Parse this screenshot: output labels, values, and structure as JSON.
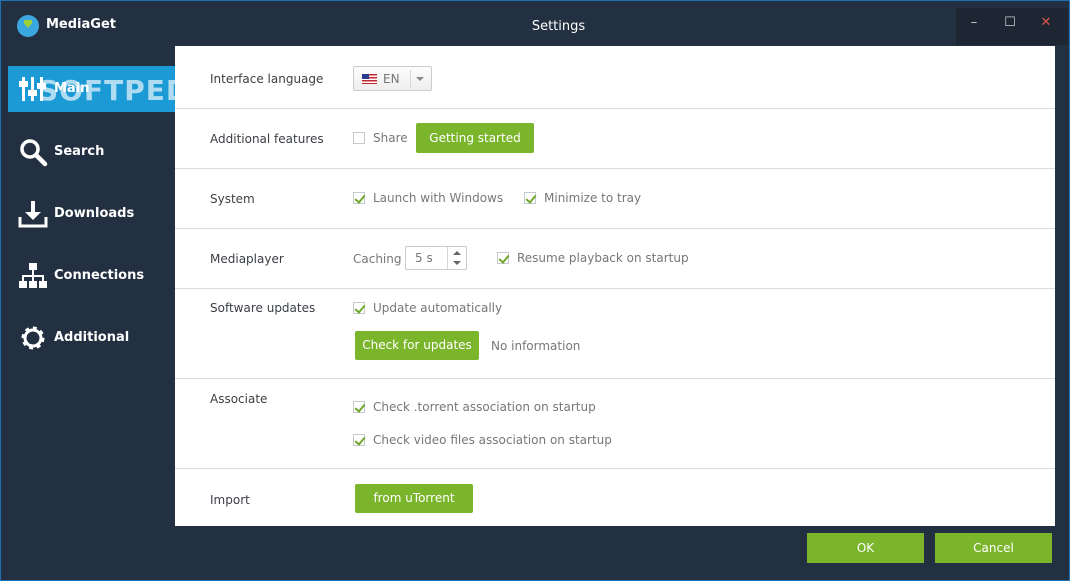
{
  "app": {
    "name": "MediaGet",
    "window_title": "Settings"
  },
  "window_controls": {
    "minimize": "–",
    "maximize": "☐",
    "close": "✕"
  },
  "sidebar": {
    "watermark": "SOFTPEDIA",
    "items": [
      {
        "label": "Main",
        "icon": "sliders-icon",
        "active": true
      },
      {
        "label": "Search",
        "icon": "search-icon",
        "active": false
      },
      {
        "label": "Downloads",
        "icon": "download-icon",
        "active": false
      },
      {
        "label": "Connections",
        "icon": "network-icon",
        "active": false
      },
      {
        "label": "Additional",
        "icon": "gear-icon",
        "active": false
      }
    ]
  },
  "settings": {
    "interface_language": {
      "label": "Interface language",
      "value": "EN"
    },
    "additional_features": {
      "label": "Additional features",
      "share_label": "Share",
      "share_checked": false,
      "button": "Getting started"
    },
    "system": {
      "label": "System",
      "launch_label": "Launch with Windows",
      "launch_checked": true,
      "tray_label": "Minimize to tray",
      "tray_checked": true
    },
    "mediaplayer": {
      "label": "Mediaplayer",
      "caching_label": "Caching",
      "caching_value": "5 s",
      "resume_label": "Resume playback on startup",
      "resume_checked": true
    },
    "software_updates": {
      "label": "Software updates",
      "auto_label": "Update automatically",
      "auto_checked": true,
      "button": "Check for updates",
      "status": "No information"
    },
    "associate": {
      "label": "Associate",
      "torrent_label": "Check .torrent association on startup",
      "torrent_checked": true,
      "video_label": "Check video files association on startup",
      "video_checked": true
    },
    "import": {
      "label": "Import",
      "button": "from uTorrent"
    }
  },
  "footer": {
    "ok": "OK",
    "cancel": "Cancel"
  },
  "colors": {
    "accent_green": "#7bb52c",
    "sidebar_active": "#1c9ad6",
    "sidebar_bg": "#233042"
  }
}
